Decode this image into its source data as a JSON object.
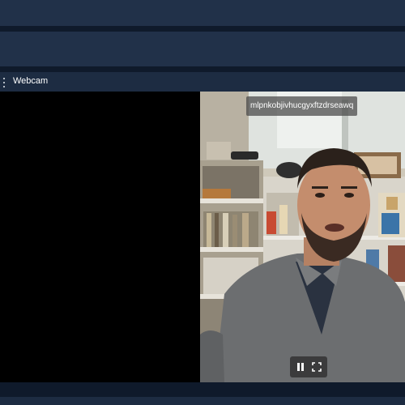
{
  "panel": {
    "title": "Webcam"
  },
  "video": {
    "overlay_text": "mlpnkobjivhucgyxftzdrseawq",
    "state": "playing"
  },
  "controls": {
    "pause_icon": "pause-icon",
    "fullscreen_icon": "fullscreen-icon"
  },
  "colors": {
    "app_background": "#0f1a2b",
    "bar": "#213149",
    "panel_header": "#1d2c42",
    "video_placeholder": "#000000"
  }
}
